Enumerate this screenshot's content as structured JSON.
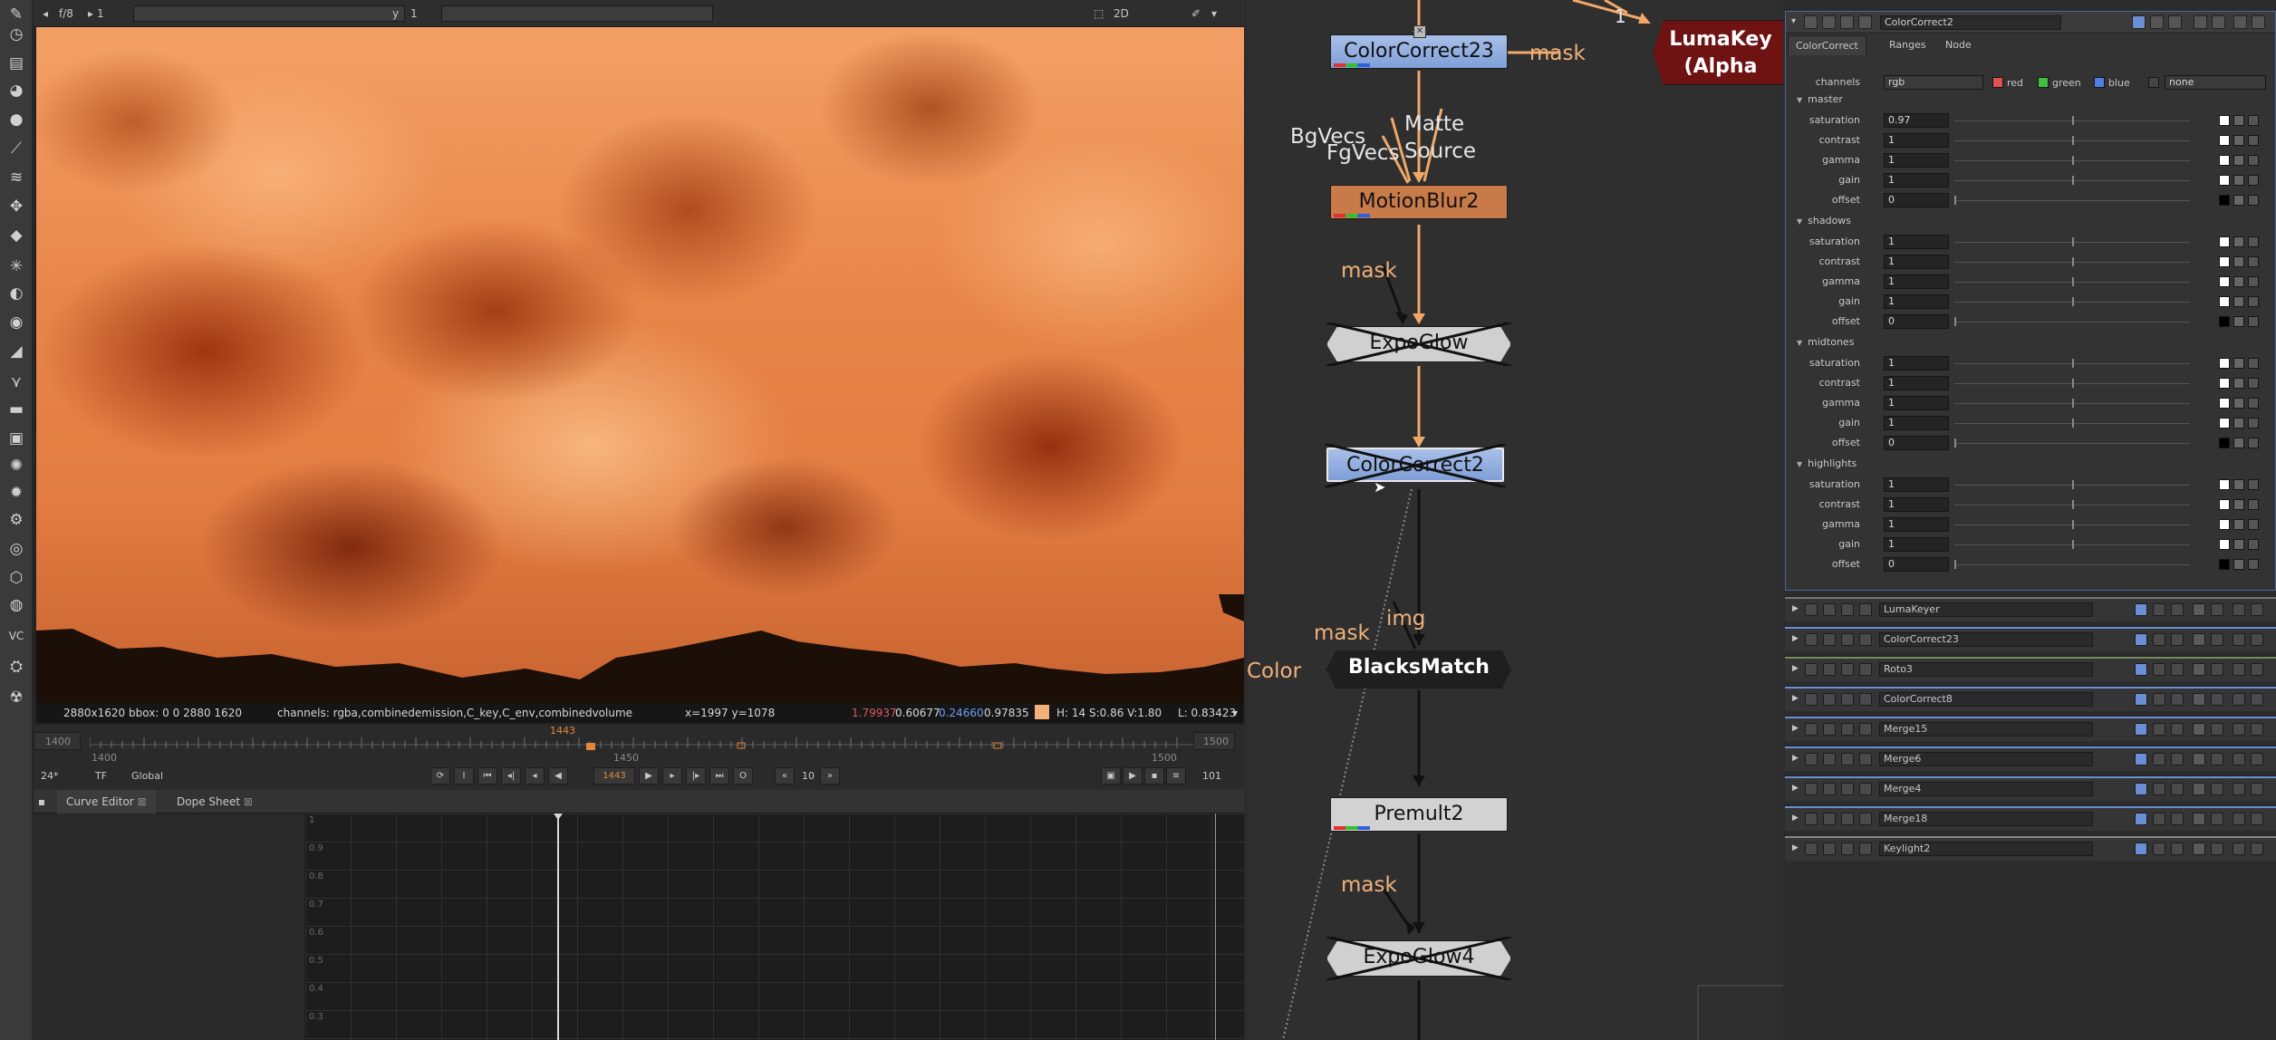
{
  "toolbar": {
    "tools": [
      "paint-icon",
      "clock-icon",
      "layers-icon",
      "color-wheel-icon",
      "circle-icon",
      "pen-icon",
      "stack-icon",
      "transform-icon",
      "cube-icon",
      "particle-icon",
      "deep-icon",
      "eye-icon",
      "keyer-icon",
      "merge-icon",
      "channel-icon",
      "film-icon",
      "filter-icon",
      "keyer-icon",
      "particles-icon",
      "gizmo-icon",
      "globe-icon",
      "settings-icon",
      "vc-icon",
      "python-icon",
      "nuke-icon"
    ],
    "vc_label": "VC"
  },
  "viewer": {
    "fstop": "f/8",
    "gain_value": "1",
    "y_label": "y",
    "y_value": "1",
    "mode_2d": "2D",
    "info_res": "2880x1620",
    "info_bbox": "bbox: 0 0 2880 1620",
    "info_channels": "channels: rgba,combinedemission,C_key,C_env,combinedvolume",
    "info_xy": "x=1997 y=1078",
    "info_r": "1.79937",
    "info_g": "0.60677",
    "info_b": "0.24660",
    "info_a": "0.97835",
    "info_hsv": "H: 14 S:0.86 V:1.80",
    "info_l": "L: 0.83423",
    "swatch_color": "#f2b07a"
  },
  "timeline": {
    "start": "1400",
    "tick_1400": "1400",
    "tick_1450": "1450",
    "tick_1500": "1500",
    "end": "1500",
    "current_frame_marker": "1443",
    "fps": "24*",
    "tf": "TF",
    "global": "Global",
    "current_frame": "1443",
    "step": "10",
    "last_frame": "101"
  },
  "curve_panel": {
    "tabs": [
      "Curve Editor",
      "Dope Sheet"
    ],
    "y_labels": [
      "1",
      "0.9",
      "0.8",
      "0.7",
      "0.6",
      "0.5",
      "0.4",
      "0.3"
    ]
  },
  "nodegraph": {
    "nodes": {
      "colorcorrect23": "ColorCorrect23",
      "lumakeyer": "LumaKey",
      "lumakeyer_sub": "(Alpha",
      "motionblur2": "MotionBlur2",
      "expoglow": "ExpoGlow",
      "colorcorrect2": "ColorCorrect2",
      "blacksmatch": "BlacksMatch",
      "premult2": "Premult2",
      "expoglow4": "ExpoGlow4"
    },
    "labels": {
      "mask_top": "mask",
      "one": "1",
      "bgvecs": "BgVecs",
      "fgvecs": "FgVecs",
      "matte": "Matte",
      "source": "Source",
      "mask_mb": "mask",
      "mask_bm": "mask",
      "img": "img",
      "color": "Color",
      "mask_pm": "mask"
    }
  },
  "properties": {
    "node_name": "ColorCorrect2",
    "tabs": [
      "ColorCorrect",
      "Ranges",
      "Node"
    ],
    "channels_label": "channels",
    "channels_value": "rgb",
    "ch_red": "red",
    "ch_green": "green",
    "ch_blue": "blue",
    "ch_mask": "none",
    "sections": {
      "master": {
        "title": "master",
        "saturation": "0.97",
        "contrast": "1",
        "gamma": "1",
        "gain": "1",
        "offset": "0"
      },
      "shadows": {
        "title": "shadows",
        "saturation": "1",
        "contrast": "1",
        "gamma": "1",
        "gain": "1",
        "offset": "0"
      },
      "midtones": {
        "title": "midtones",
        "saturation": "1",
        "contrast": "1",
        "gamma": "1",
        "gain": "1",
        "offset": "0"
      },
      "highlights": {
        "title": "highlights",
        "saturation": "1",
        "contrast": "1",
        "gamma": "1",
        "gain": "1",
        "offset": "0"
      }
    },
    "param_labels": {
      "saturation": "saturation",
      "contrast": "contrast",
      "gamma": "gamma",
      "gain": "gain",
      "offset": "offset"
    },
    "node_panels": [
      "LumaKeyer",
      "ColorCorrect23",
      "Roto3",
      "ColorCorrect8",
      "Merge15",
      "Merge6",
      "Merge4",
      "Merge18",
      "Keylight2"
    ]
  },
  "colors": {
    "pipe": "#f0a868",
    "accent": "#6b8fd4",
    "lumakeyer": "#6e1212",
    "motionblur": "#c87a48"
  }
}
